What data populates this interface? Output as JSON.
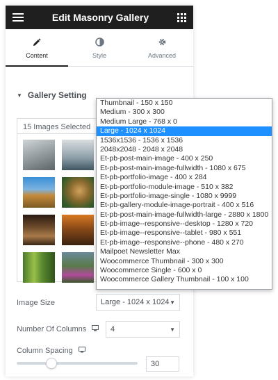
{
  "header": {
    "title": "Edit Masonry Gallery"
  },
  "tabs": [
    {
      "label": "Content",
      "icon": "pencil-icon",
      "active": true
    },
    {
      "label": "Style",
      "icon": "contrast-icon",
      "active": false
    },
    {
      "label": "Advanced",
      "icon": "gear-icon",
      "active": false
    }
  ],
  "section": {
    "title": "Gallery Setting"
  },
  "gallery": {
    "selected_text": "15 Images Selected",
    "visible_thumbnails": 10
  },
  "image_size": {
    "label": "Image Size",
    "value": "Large - 1024 x 1024",
    "options": [
      "Thumbnail - 150 x 150",
      "Medium - 300 x 300",
      "Medium Large - 768 x 0",
      "Large - 1024 x 1024",
      "1536x1536 - 1536 x 1536",
      "2048x2048 - 2048 x 2048",
      "Et-pb-post-main-image - 400 x 250",
      "Et-pb-post-main-image-fullwidth - 1080 x 675",
      "Et-pb-portfolio-image - 400 x 284",
      "Et-pb-portfolio-module-image - 510 x 382",
      "Et-pb-portfolio-image-single - 1080 x 9999",
      "Et-pb-gallery-module-image-portrait - 400 x 516",
      "Et-pb-post-main-image-fullwidth-large - 2880 x 1800",
      "Et-pb-image--responsive--desktop - 1280 x 720",
      "Et-pb-image--responsive--tablet - 980 x 551",
      "Et-pb-image--responsive--phone - 480 x 270",
      "Mailpoet Newsletter Max",
      "Woocommerce Thumbnail - 300 x 300",
      "Woocommerce Single - 600 x 0",
      "Woocommerce Gallery Thumbnail - 100 x 100"
    ],
    "selected_index": 3
  },
  "columns": {
    "label": "Number Of Columns",
    "value": "4"
  },
  "spacing": {
    "label": "Column Spacing",
    "value": "30"
  },
  "colors": {
    "header_bg": "#1f1f1f",
    "selected_option": "#1e90ff",
    "panel_bg": "#e9edf0"
  }
}
